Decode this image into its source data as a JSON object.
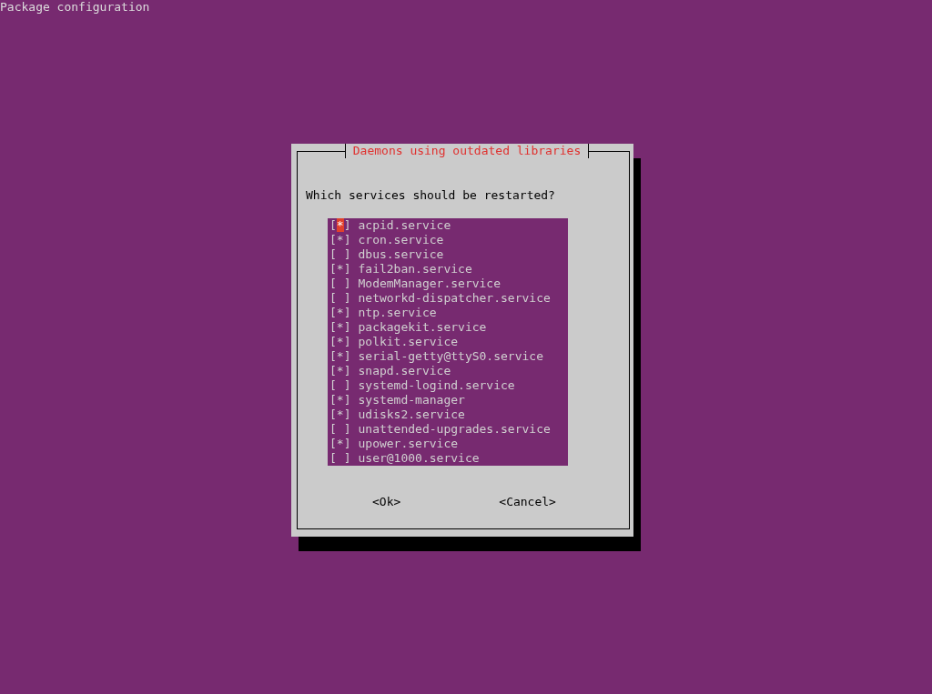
{
  "header": "Package configuration",
  "dialog": {
    "title": "Daemons using outdated libraries",
    "prompt": "Which services should be restarted?",
    "checkbox": {
      "open": "[",
      "close": "]",
      "mark": "*"
    },
    "items": [
      {
        "label": "acpid.service",
        "checked": true,
        "selected": true
      },
      {
        "label": "cron.service",
        "checked": true,
        "selected": false
      },
      {
        "label": "dbus.service",
        "checked": false,
        "selected": false
      },
      {
        "label": "fail2ban.service",
        "checked": true,
        "selected": false
      },
      {
        "label": "ModemManager.service",
        "checked": false,
        "selected": false
      },
      {
        "label": "networkd-dispatcher.service",
        "checked": false,
        "selected": false
      },
      {
        "label": "ntp.service",
        "checked": true,
        "selected": false
      },
      {
        "label": "packagekit.service",
        "checked": true,
        "selected": false
      },
      {
        "label": "polkit.service",
        "checked": true,
        "selected": false
      },
      {
        "label": "serial-getty@ttyS0.service",
        "checked": true,
        "selected": false
      },
      {
        "label": "snapd.service",
        "checked": true,
        "selected": false
      },
      {
        "label": "systemd-logind.service",
        "checked": false,
        "selected": false
      },
      {
        "label": "systemd-manager",
        "checked": true,
        "selected": false
      },
      {
        "label": "udisks2.service",
        "checked": true,
        "selected": false
      },
      {
        "label": "unattended-upgrades.service",
        "checked": false,
        "selected": false
      },
      {
        "label": "upower.service",
        "checked": true,
        "selected": false
      },
      {
        "label": "user@1000.service",
        "checked": false,
        "selected": false
      }
    ],
    "buttons": [
      "<Ok>",
      "<Cancel>"
    ]
  }
}
